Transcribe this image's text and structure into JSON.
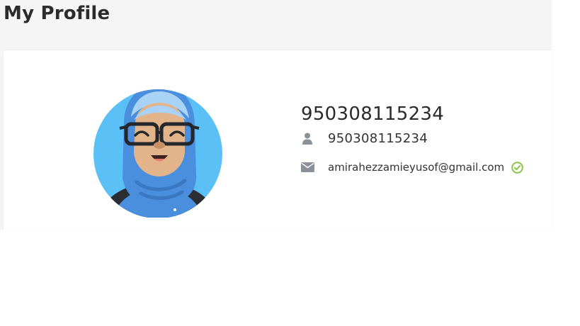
{
  "page": {
    "title": "My Profile"
  },
  "profile": {
    "name": "950308115234",
    "username": "950308115234",
    "username_icon": "user-icon",
    "email": "amirahezzamieyusof@gmail.com",
    "email_icon": "envelope-icon",
    "email_verified_icon": "check-circle-icon"
  },
  "colors": {
    "avatar_background": "#5bc0f5",
    "hijab": "#4a90e2",
    "icon_gray": "#8a9199",
    "verified_green": "#8bc34a"
  }
}
